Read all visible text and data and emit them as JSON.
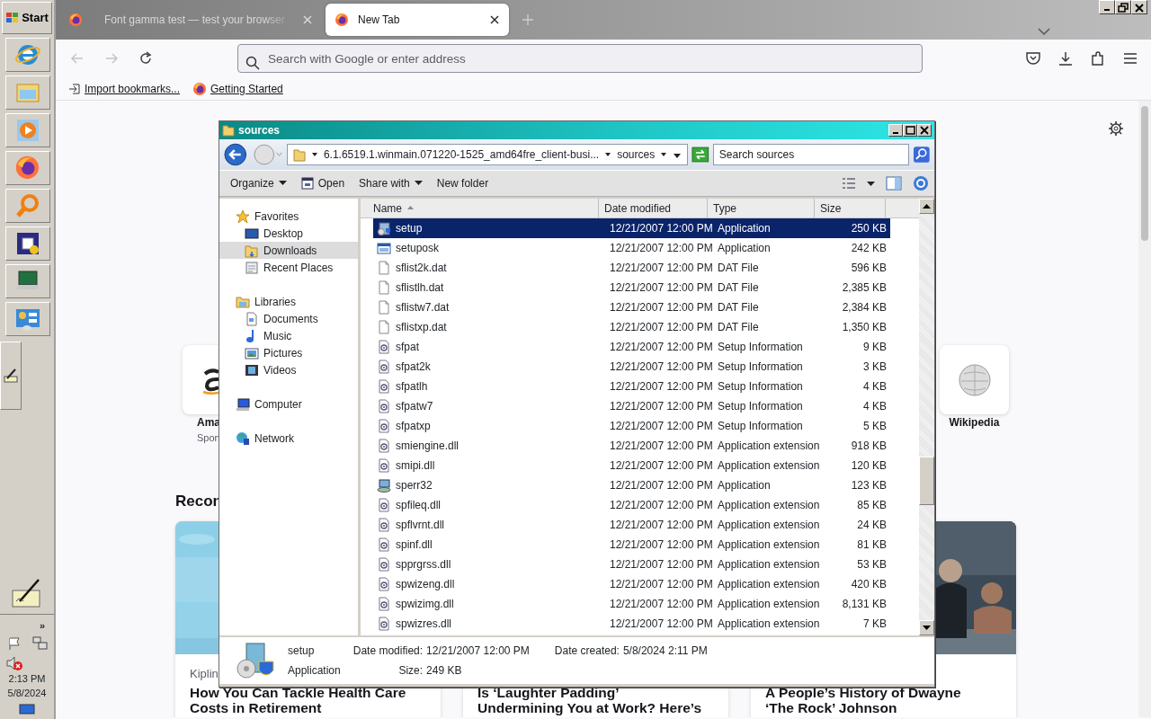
{
  "taskbar": {
    "start_label": "Start",
    "tray": {
      "expand": "»",
      "time": "2:13 PM",
      "date": "5/8/2024"
    }
  },
  "browser": {
    "tabs": [
      {
        "title": "Font gamma test — test your browser",
        "selected": false
      },
      {
        "title": "New Tab",
        "selected": true
      }
    ],
    "nav_buttons": [
      {
        "kind": "back",
        "disabled": true
      },
      {
        "kind": "forward",
        "disabled": true
      },
      {
        "kind": "reload",
        "disabled": false
      }
    ],
    "address": {
      "placeholder": "Search with Google or enter address"
    },
    "bookmarks": [
      {
        "label": "Import bookmarks...",
        "kind": "import"
      },
      {
        "label": "Getting Started",
        "kind": "firefox"
      }
    ],
    "new_tab": {
      "shortcuts": [
        {
          "label": "Ama",
          "sublabel": "Spon",
          "kind": "amazon"
        },
        {
          "label": "Wikipedia",
          "kind": "wikipedia"
        }
      ],
      "recommended_heading": "Recon",
      "stories": [
        {
          "source": "Kiplin",
          "lines": [
            "How You Can Tackle Health Care",
            "Costs in Retirement"
          ]
        },
        {
          "lines": [
            "Is ‘Laughter Padding’",
            "Undermining You at Work? Here’s"
          ]
        },
        {
          "lines": [
            "A People’s History of Dwayne",
            "‘The Rock’ Johnson"
          ]
        }
      ]
    }
  },
  "explorer": {
    "title": "sources",
    "breadcrumb": [
      "6.1.6519.1.winmain.071220-1525_amd64fre_client-busi...",
      "sources"
    ],
    "search": {
      "placeholder": "Search sources"
    },
    "toolbar": [
      {
        "label": "Organize",
        "kind": "menu"
      },
      {
        "label": "Open",
        "kind": "open"
      },
      {
        "label": "Share with",
        "kind": "menu"
      },
      {
        "label": "New folder",
        "kind": "plain"
      }
    ],
    "nav": [
      {
        "label": "Favorites",
        "kind": "star",
        "selected": false,
        "children": [
          {
            "label": "Desktop",
            "kind": "desktop",
            "selected": false
          },
          {
            "label": "Downloads",
            "kind": "folder",
            "selected": true
          },
          {
            "label": "Recent Places",
            "kind": "recent",
            "selected": false
          }
        ]
      },
      {
        "label": "Libraries",
        "kind": "library",
        "selected": false,
        "children": [
          {
            "label": "Documents",
            "kind": "document",
            "selected": false
          },
          {
            "label": "Music",
            "kind": "music",
            "selected": false
          },
          {
            "label": "Pictures",
            "kind": "pictures",
            "selected": false
          },
          {
            "label": "Videos",
            "kind": "videos",
            "selected": false
          }
        ]
      },
      {
        "label": "Computer",
        "kind": "computer",
        "selected": false
      },
      {
        "label": "Network",
        "kind": "network",
        "selected": false
      }
    ],
    "columns": [
      {
        "label": "Name",
        "sorted": true
      },
      {
        "label": "Date modified",
        "sorted": false
      },
      {
        "label": "Type",
        "sorted": false
      },
      {
        "label": "Size",
        "sorted": false
      }
    ],
    "rows": [
      {
        "name": "setup",
        "date": "12/21/2007 12:00 PM",
        "type": "Application",
        "size": "250 KB",
        "kind": "installer",
        "selected": true
      },
      {
        "name": "setuposk",
        "date": "12/21/2007 12:00 PM",
        "type": "Application",
        "size": "242 KB",
        "kind": "window",
        "selected": false
      },
      {
        "name": "sflist2k.dat",
        "date": "12/21/2007 12:00 PM",
        "type": "DAT File",
        "size": "596 KB",
        "kind": "blank",
        "selected": false
      },
      {
        "name": "sflistlh.dat",
        "date": "12/21/2007 12:00 PM",
        "type": "DAT File",
        "size": "2,385 KB",
        "kind": "blank",
        "selected": false
      },
      {
        "name": "sflistw7.dat",
        "date": "12/21/2007 12:00 PM",
        "type": "DAT File",
        "size": "2,384 KB",
        "kind": "blank",
        "selected": false
      },
      {
        "name": "sflistxp.dat",
        "date": "12/21/2007 12:00 PM",
        "type": "DAT File",
        "size": "1,350 KB",
        "kind": "blank",
        "selected": false
      },
      {
        "name": "sfpat",
        "date": "12/21/2007 12:00 PM",
        "type": "Setup Information",
        "size": "9 KB",
        "kind": "config",
        "selected": false
      },
      {
        "name": "sfpat2k",
        "date": "12/21/2007 12:00 PM",
        "type": "Setup Information",
        "size": "3 KB",
        "kind": "config",
        "selected": false
      },
      {
        "name": "sfpatlh",
        "date": "12/21/2007 12:00 PM",
        "type": "Setup Information",
        "size": "4 KB",
        "kind": "config",
        "selected": false
      },
      {
        "name": "sfpatw7",
        "date": "12/21/2007 12:00 PM",
        "type": "Setup Information",
        "size": "4 KB",
        "kind": "config",
        "selected": false
      },
      {
        "name": "sfpatxp",
        "date": "12/21/2007 12:00 PM",
        "type": "Setup Information",
        "size": "5 KB",
        "kind": "config",
        "selected": false
      },
      {
        "name": "smiengine.dll",
        "date": "12/21/2007 12:00 PM",
        "type": "Application extension",
        "size": "918 KB",
        "kind": "config",
        "selected": false
      },
      {
        "name": "smipi.dll",
        "date": "12/21/2007 12:00 PM",
        "type": "Application extension",
        "size": "120 KB",
        "kind": "config",
        "selected": false
      },
      {
        "name": "sperr32",
        "date": "12/21/2007 12:00 PM",
        "type": "Application",
        "size": "123 KB",
        "kind": "computer",
        "selected": false
      },
      {
        "name": "spfileq.dll",
        "date": "12/21/2007 12:00 PM",
        "type": "Application extension",
        "size": "85 KB",
        "kind": "config",
        "selected": false
      },
      {
        "name": "spflvrnt.dll",
        "date": "12/21/2007 12:00 PM",
        "type": "Application extension",
        "size": "24 KB",
        "kind": "config",
        "selected": false
      },
      {
        "name": "spinf.dll",
        "date": "12/21/2007 12:00 PM",
        "type": "Application extension",
        "size": "81 KB",
        "kind": "config",
        "selected": false
      },
      {
        "name": "spprgrss.dll",
        "date": "12/21/2007 12:00 PM",
        "type": "Application extension",
        "size": "53 KB",
        "kind": "config",
        "selected": false
      },
      {
        "name": "spwizeng.dll",
        "date": "12/21/2007 12:00 PM",
        "type": "Application extension",
        "size": "420 KB",
        "kind": "config",
        "selected": false
      },
      {
        "name": "spwizimg.dll",
        "date": "12/21/2007 12:00 PM",
        "type": "Application extension",
        "size": "8,131 KB",
        "kind": "config",
        "selected": false
      },
      {
        "name": "spwizres.dll",
        "date": "12/21/2007 12:00 PM",
        "type": "Application extension",
        "size": "7 KB",
        "kind": "config",
        "selected": false
      }
    ],
    "details": {
      "name": "setup",
      "type": "Application",
      "fields": [
        {
          "label": "Date modified:",
          "value": "12/21/2007 12:00 PM"
        },
        {
          "label": "Size:",
          "value": "249 KB"
        },
        {
          "label": "Date created:",
          "value": "5/8/2024 2:11 PM"
        }
      ]
    }
  }
}
